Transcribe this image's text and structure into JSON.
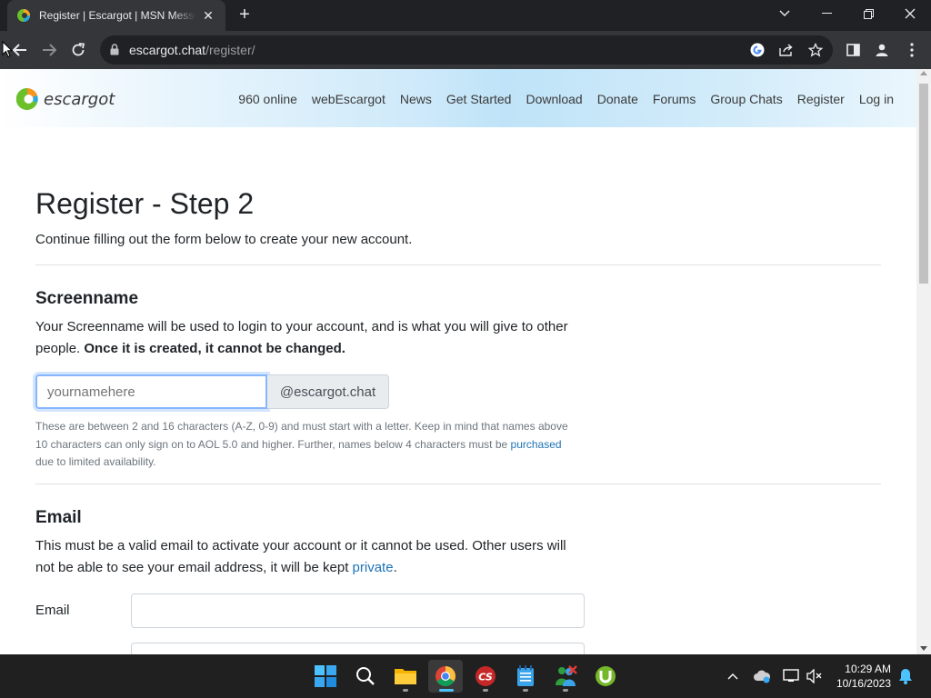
{
  "browser": {
    "tab_title": "Register | Escargot | MSN Messenger",
    "url_host": "escargot.chat",
    "url_path": "/register/"
  },
  "site": {
    "logo_text": "escargot",
    "nav": [
      "960 online",
      "webEscargot",
      "News",
      "Get Started",
      "Download",
      "Donate",
      "Forums",
      "Group Chats",
      "Register",
      "Log in"
    ]
  },
  "page": {
    "title": "Register - Step 2",
    "subtitle": "Continue filling out the form below to create your new account.",
    "screenname": {
      "heading": "Screenname",
      "desc": "Your Screenname will be used to login to your account, and is what you will give to other people.",
      "desc_bold": "Once it is created, it cannot be changed.",
      "placeholder": "yournamehere",
      "suffix": "@escargot.chat",
      "help": "These are between 2 and 16 characters (A-Z, 0-9) and must start with a letter. Keep in mind that names above 10 characters can only sign on to AOL 5.0 and higher. Further, names below 4 characters must be",
      "help_link": "purchased",
      "help_end": "due to limited availability."
    },
    "email": {
      "heading": "Email",
      "desc": "This must be a valid email to activate your account or it cannot be used. Other users will not be able to see your email address, it will be kept",
      "desc_link": "private",
      "desc_end": ".",
      "label": "Email"
    }
  },
  "taskbar": {
    "time": "10:29 AM",
    "date": "10/16/2023"
  },
  "colors": {
    "link": "#1f73b7",
    "focus_border": "#86b7fe",
    "taskbar_active": "#4cc2ff"
  }
}
